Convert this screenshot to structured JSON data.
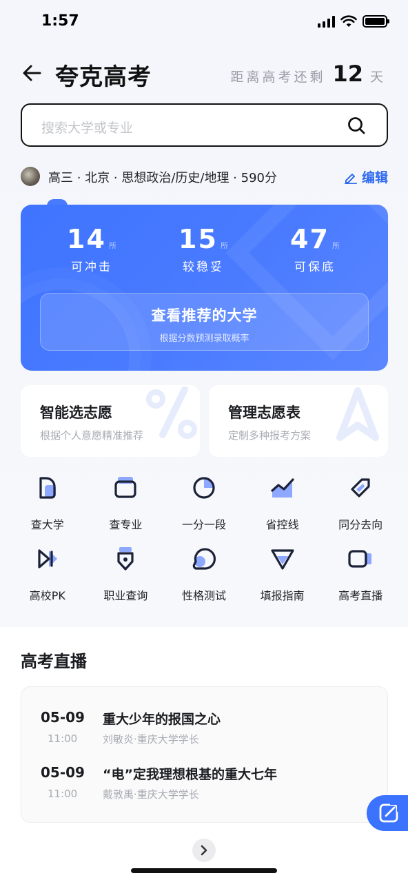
{
  "status": {
    "time": "1:57"
  },
  "header": {
    "title": "夸克高考",
    "countdown_prefix": "距离高考还剩",
    "countdown_days": "12",
    "countdown_suffix": "天"
  },
  "search": {
    "placeholder": "搜索大学或专业"
  },
  "profile": {
    "summary": "高三 · 北京 · 思想政治/历史/地理 · 590分",
    "edit_label": "编辑"
  },
  "recommend": {
    "stats": [
      {
        "value": "14",
        "unit": "所",
        "label": "可冲击"
      },
      {
        "value": "15",
        "unit": "所",
        "label": "较稳妥"
      },
      {
        "value": "47",
        "unit": "所",
        "label": "可保底"
      }
    ],
    "button_title": "查看推荐的大学",
    "button_subtitle": "根据分数预测录取概率"
  },
  "features": [
    {
      "title": "智能选志愿",
      "subtitle": "根据个人意愿精准推荐"
    },
    {
      "title": "管理志愿表",
      "subtitle": "定制多种报考方案"
    }
  ],
  "grid": [
    {
      "label": "查大学",
      "icon": "school-icon"
    },
    {
      "label": "查专业",
      "icon": "major-icon"
    },
    {
      "label": "一分一段",
      "icon": "pie-icon"
    },
    {
      "label": "省控线",
      "icon": "trend-line-icon"
    },
    {
      "label": "同分去向",
      "icon": "tag-icon"
    },
    {
      "label": "高校PK",
      "icon": "versus-icon"
    },
    {
      "label": "职业查询",
      "icon": "badge-icon"
    },
    {
      "label": "性格测试",
      "icon": "personality-icon"
    },
    {
      "label": "填报指南",
      "icon": "guide-icon"
    },
    {
      "label": "高考直播",
      "icon": "video-icon"
    }
  ],
  "live": {
    "section_title": "高考直播",
    "items": [
      {
        "date": "05-09",
        "time": "11:00",
        "title": "重大少年的报国之心",
        "speaker": "刘敏炎·重庆大学学长"
      },
      {
        "date": "05-09",
        "time": "11:00",
        "title": "“电”定我理想根基的重大七年",
        "speaker": "戴敦禹·重庆大学学长"
      }
    ]
  },
  "colors": {
    "accent": "#3f74ff",
    "text": "#1b1c20",
    "muted": "#a8abb2"
  }
}
